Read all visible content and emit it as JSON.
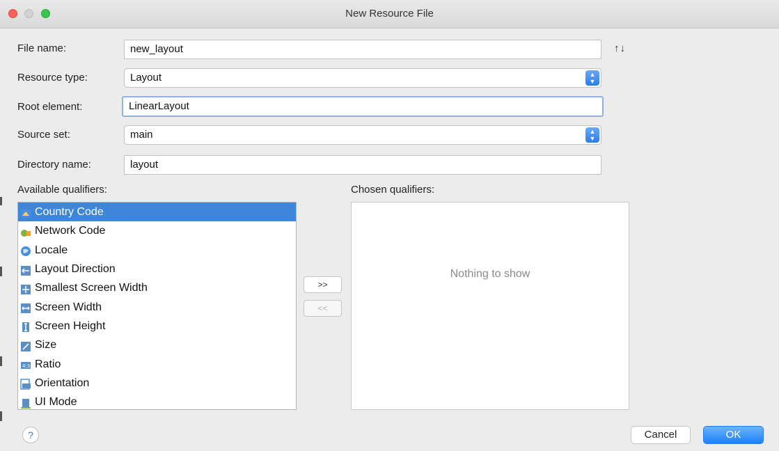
{
  "window": {
    "title": "New Resource File"
  },
  "form": {
    "file_name_label": "File name:",
    "file_name_value": "new_layout",
    "sort_icon": "↑↓",
    "resource_type_label": "Resource type:",
    "resource_type_value": "Layout",
    "root_element_label": "Root element:",
    "root_element_value": "LinearLayout",
    "source_set_label": "Source set:",
    "source_set_value": "main",
    "directory_name_label": "Directory name:",
    "directory_name_value": "layout"
  },
  "available": {
    "label": "Available qualifiers:",
    "items": [
      {
        "label": "Country Code",
        "icon": "country-code-icon",
        "selected": true
      },
      {
        "label": "Network Code",
        "icon": "network-code-icon"
      },
      {
        "label": "Locale",
        "icon": "globe-icon"
      },
      {
        "label": "Layout Direction",
        "icon": "layout-direction-icon"
      },
      {
        "label": "Smallest Screen Width",
        "icon": "smallest-width-icon"
      },
      {
        "label": "Screen Width",
        "icon": "screen-width-icon"
      },
      {
        "label": "Screen Height",
        "icon": "screen-height-icon"
      },
      {
        "label": "Size",
        "icon": "size-icon"
      },
      {
        "label": "Ratio",
        "icon": "ratio-icon"
      },
      {
        "label": "Orientation",
        "icon": "orientation-icon"
      },
      {
        "label": "UI Mode",
        "icon": "ui-mode-icon"
      }
    ]
  },
  "chosen": {
    "label": "Chosen qualifiers:",
    "empty_text": "Nothing to show"
  },
  "buttons": {
    "add": ">>",
    "remove": "<<",
    "help": "?",
    "cancel": "Cancel",
    "ok": "OK"
  },
  "colors": {
    "accent": "#3d86d8",
    "ok_button": "#1a82fb"
  }
}
